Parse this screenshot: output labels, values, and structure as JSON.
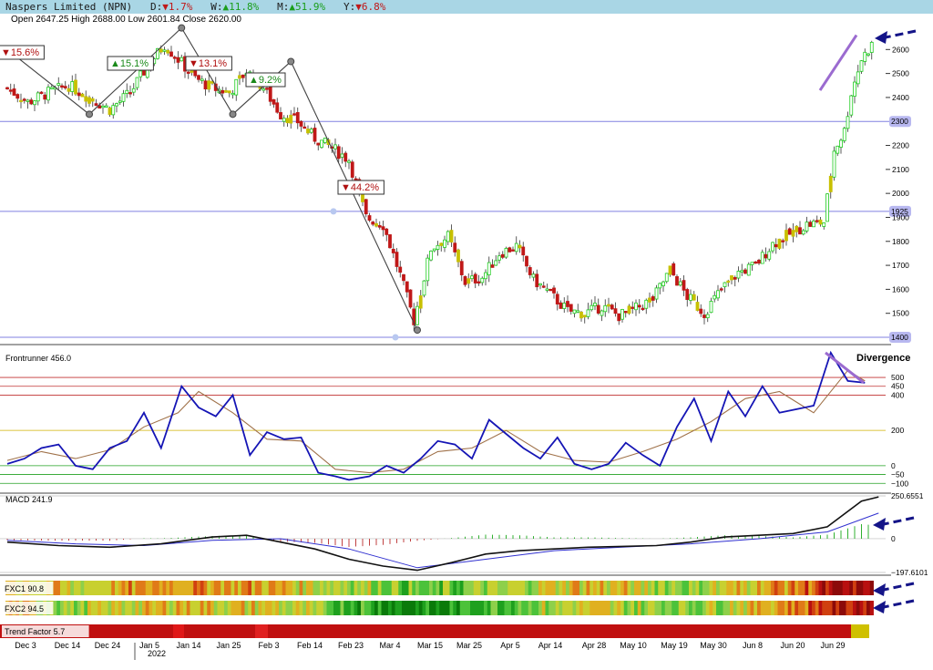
{
  "header": {
    "name": "Naspers Limited (NPN)",
    "d_label": "D:",
    "d_value": "▼1.7%",
    "w_label": "W:",
    "w_value": "▲11.8%",
    "m_label": "M:",
    "m_value": "▲51.9%",
    "y_label": "Y:",
    "y_value": "▼6.8%"
  },
  "ohlc_text": "Open 2647.25  High 2688.00  Low 2601.84  Close 2620.00",
  "colors": {
    "up": "#1fcc1f",
    "down": "#c01818",
    "neutral": "#c8c000",
    "blue_line": "#1515b5",
    "brown_line": "#a0724a",
    "purple": "#9b6bd0",
    "arrow": "#141488"
  },
  "chart_data": [
    {
      "type": "candlestick",
      "ylim": [
        1400,
        2700
      ],
      "yticks": [
        1500,
        1600,
        1700,
        1800,
        1900,
        2000,
        2100,
        2200,
        2400,
        2500,
        2600
      ],
      "highlighted_levels": [
        {
          "value": 2300,
          "label": "2300"
        },
        {
          "value": 1925,
          "label": "1925"
        },
        {
          "value": 1400,
          "label": "1400"
        }
      ],
      "x_labels": [
        "Dec 3",
        "Dec 14",
        "Dec 24",
        "Jan 5",
        "Jan 14",
        "Jan 25",
        "Feb 3",
        "Feb 14",
        "Feb 23",
        "Mar 4",
        "Mar 15",
        "Mar 25",
        "Apr 5",
        "Apr 14",
        "Apr 28",
        "May 10",
        "May 19",
        "May 30",
        "Jun 8",
        "Jun 20",
        "Jun 29"
      ],
      "year_label": "2022",
      "swing_annotations": [
        "▼15.6%",
        "▲15.1%",
        "▼13.1%",
        "▲9.2%",
        "▼44.2%"
      ],
      "close_path": [
        [
          0,
          2440
        ],
        [
          6,
          2380
        ],
        [
          12,
          2420
        ],
        [
          18,
          2450
        ],
        [
          24,
          2400
        ],
        [
          30,
          2350
        ],
        [
          36,
          2420
        ],
        [
          41,
          2530
        ],
        [
          46,
          2620
        ],
        [
          50,
          2560
        ],
        [
          55,
          2480
        ],
        [
          60,
          2440
        ],
        [
          65,
          2420
        ],
        [
          70,
          2510
        ],
        [
          75,
          2440
        ],
        [
          80,
          2330
        ],
        [
          85,
          2300
        ],
        [
          90,
          2230
        ],
        [
          95,
          2190
        ],
        [
          100,
          2140
        ],
        [
          105,
          1900
        ],
        [
          110,
          1870
        ],
        [
          115,
          1660
        ],
        [
          119,
          1470
        ],
        [
          124,
          1770
        ],
        [
          129,
          1820
        ],
        [
          134,
          1630
        ],
        [
          139,
          1650
        ],
        [
          144,
          1750
        ],
        [
          149,
          1780
        ],
        [
          154,
          1640
        ],
        [
          159,
          1580
        ],
        [
          164,
          1510
        ],
        [
          169,
          1500
        ],
        [
          174,
          1530
        ],
        [
          179,
          1490
        ],
        [
          184,
          1520
        ],
        [
          189,
          1560
        ],
        [
          194,
          1680
        ],
        [
          199,
          1570
        ],
        [
          204,
          1500
        ],
        [
          209,
          1600
        ],
        [
          214,
          1670
        ],
        [
          219,
          1700
        ],
        [
          224,
          1790
        ],
        [
          229,
          1830
        ],
        [
          234,
          1870
        ],
        [
          239,
          1880
        ],
        [
          242,
          2180
        ],
        [
          245,
          2260
        ],
        [
          247,
          2420
        ],
        [
          250,
          2560
        ],
        [
          253,
          2620
        ]
      ]
    },
    {
      "type": "line",
      "title": "Frontrunner 456.0",
      "annotation": "Divergence",
      "ylim": [
        -140,
        650
      ],
      "levels": [
        500,
        450,
        400,
        200,
        0,
        -50,
        -100
      ],
      "level_labels": [
        "500",
        "450",
        "400",
        "200",
        "0",
        "−50",
        "−100"
      ],
      "series": [
        {
          "values": [
            [
              0,
              10
            ],
            [
              5,
              40
            ],
            [
              10,
              100
            ],
            [
              15,
              120
            ],
            [
              20,
              0
            ],
            [
              25,
              -20
            ],
            [
              30,
              100
            ],
            [
              35,
              140
            ],
            [
              40,
              300
            ],
            [
              45,
              100
            ],
            [
              51,
              450
            ],
            [
              56,
              330
            ],
            [
              61,
              280
            ],
            [
              66,
              400
            ],
            [
              71,
              60
            ],
            [
              76,
              190
            ],
            [
              81,
              150
            ],
            [
              86,
              160
            ],
            [
              91,
              -40
            ],
            [
              96,
              -60
            ],
            [
              100,
              -80
            ],
            [
              106,
              -60
            ],
            [
              111,
              0
            ],
            [
              116,
              -40
            ],
            [
              121,
              40
            ],
            [
              126,
              140
            ],
            [
              131,
              120
            ],
            [
              136,
              40
            ],
            [
              141,
              260
            ],
            [
              146,
              180
            ],
            [
              151,
              100
            ],
            [
              156,
              40
            ],
            [
              161,
              160
            ],
            [
              166,
              10
            ],
            [
              171,
              -20
            ],
            [
              176,
              10
            ],
            [
              181,
              130
            ],
            [
              186,
              60
            ],
            [
              191,
              0
            ],
            [
              196,
              220
            ],
            [
              201,
              380
            ],
            [
              206,
              140
            ],
            [
              211,
              420
            ],
            [
              216,
              280
            ],
            [
              221,
              450
            ],
            [
              226,
              300
            ],
            [
              231,
              320
            ],
            [
              236,
              340
            ],
            [
              241,
              640
            ],
            [
              246,
              480
            ],
            [
              251,
              470
            ]
          ]
        },
        {
          "values": [
            [
              0,
              30
            ],
            [
              10,
              80
            ],
            [
              20,
              40
            ],
            [
              30,
              90
            ],
            [
              40,
              220
            ],
            [
              50,
              300
            ],
            [
              56,
              420
            ],
            [
              66,
              300
            ],
            [
              76,
              150
            ],
            [
              86,
              140
            ],
            [
              96,
              -20
            ],
            [
              106,
              -40
            ],
            [
              116,
              -20
            ],
            [
              126,
              80
            ],
            [
              136,
              100
            ],
            [
              146,
              200
            ],
            [
              156,
              80
            ],
            [
              166,
              30
            ],
            [
              176,
              20
            ],
            [
              186,
              80
            ],
            [
              196,
              150
            ],
            [
              206,
              250
            ],
            [
              216,
              380
            ],
            [
              226,
              420
            ],
            [
              236,
              300
            ],
            [
              246,
              540
            ],
            [
              251,
              480
            ]
          ]
        }
      ]
    },
    {
      "type": "bar+line",
      "title": "MACD 241.9",
      "ylim": [
        -197.6101,
        250.6551
      ],
      "ytick_labels": [
        "250.6551",
        "0",
        "−197.6101"
      ],
      "macd": [
        [
          0,
          -20
        ],
        [
          15,
          -40
        ],
        [
          30,
          -50
        ],
        [
          45,
          -30
        ],
        [
          60,
          10
        ],
        [
          70,
          20
        ],
        [
          80,
          -20
        ],
        [
          90,
          -60
        ],
        [
          100,
          -120
        ],
        [
          110,
          -160
        ],
        [
          120,
          -185
        ],
        [
          130,
          -140
        ],
        [
          140,
          -90
        ],
        [
          150,
          -70
        ],
        [
          160,
          -60
        ],
        [
          170,
          -50
        ],
        [
          180,
          -45
        ],
        [
          190,
          -40
        ],
        [
          200,
          -20
        ],
        [
          210,
          10
        ],
        [
          220,
          20
        ],
        [
          230,
          30
        ],
        [
          240,
          70
        ],
        [
          250,
          220
        ],
        [
          255,
          245
        ]
      ],
      "signal": [
        [
          0,
          -10
        ],
        [
          20,
          -30
        ],
        [
          40,
          -40
        ],
        [
          60,
          -10
        ],
        [
          80,
          0
        ],
        [
          100,
          -60
        ],
        [
          120,
          -170
        ],
        [
          140,
          -120
        ],
        [
          160,
          -70
        ],
        [
          180,
          -50
        ],
        [
          200,
          -30
        ],
        [
          220,
          0
        ],
        [
          240,
          40
        ],
        [
          255,
          150
        ]
      ]
    },
    {
      "type": "heatmap",
      "title": "FXC1 90.8"
    },
    {
      "type": "heatmap",
      "title": "FXC2 94.5"
    },
    {
      "type": "heatmap",
      "title": "Trend Factor 5.7"
    }
  ]
}
